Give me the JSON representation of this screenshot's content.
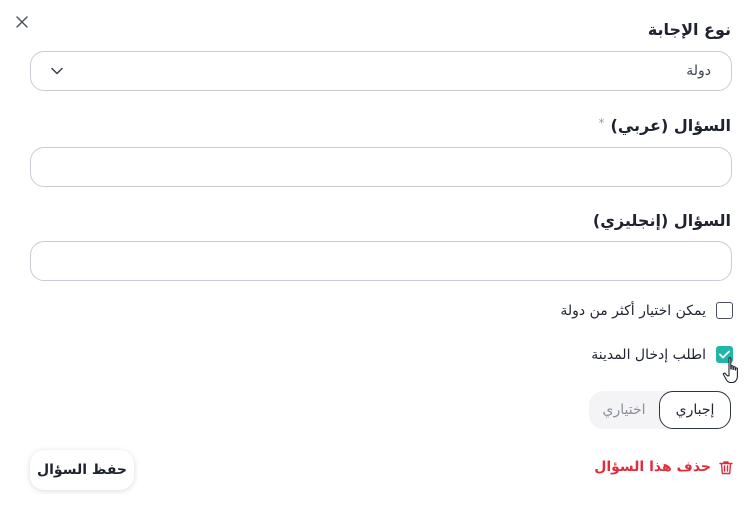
{
  "form": {
    "answer_type_label": "نوع الإجابة",
    "answer_type_value": "دولة",
    "question_ar_label": "السؤال (عربي)",
    "required_star": "*",
    "question_ar_value": "",
    "question_en_label": "السؤال (إنجليزي)",
    "question_en_value": ""
  },
  "options": {
    "multi_country_label": "يمكن اختيار أكثر من دولة",
    "multi_country_checked": false,
    "require_city_label": "اطلب إدخال المدينة",
    "require_city_checked": true
  },
  "toggle": {
    "mandatory_label": "إجباري",
    "optional_label": "اختياري",
    "selected": "mandatory"
  },
  "actions": {
    "save_label": "حفظ السؤال",
    "delete_label": "حذف هذا السؤال"
  },
  "colors": {
    "accent": "#1fb8a8",
    "danger": "#e02d3c",
    "text": "#1f2330"
  },
  "icons": {
    "close": "close-icon",
    "chevron": "chevron-down-icon",
    "check": "check-icon",
    "trash": "trash-icon",
    "pointer": "hand-pointer-icon"
  }
}
